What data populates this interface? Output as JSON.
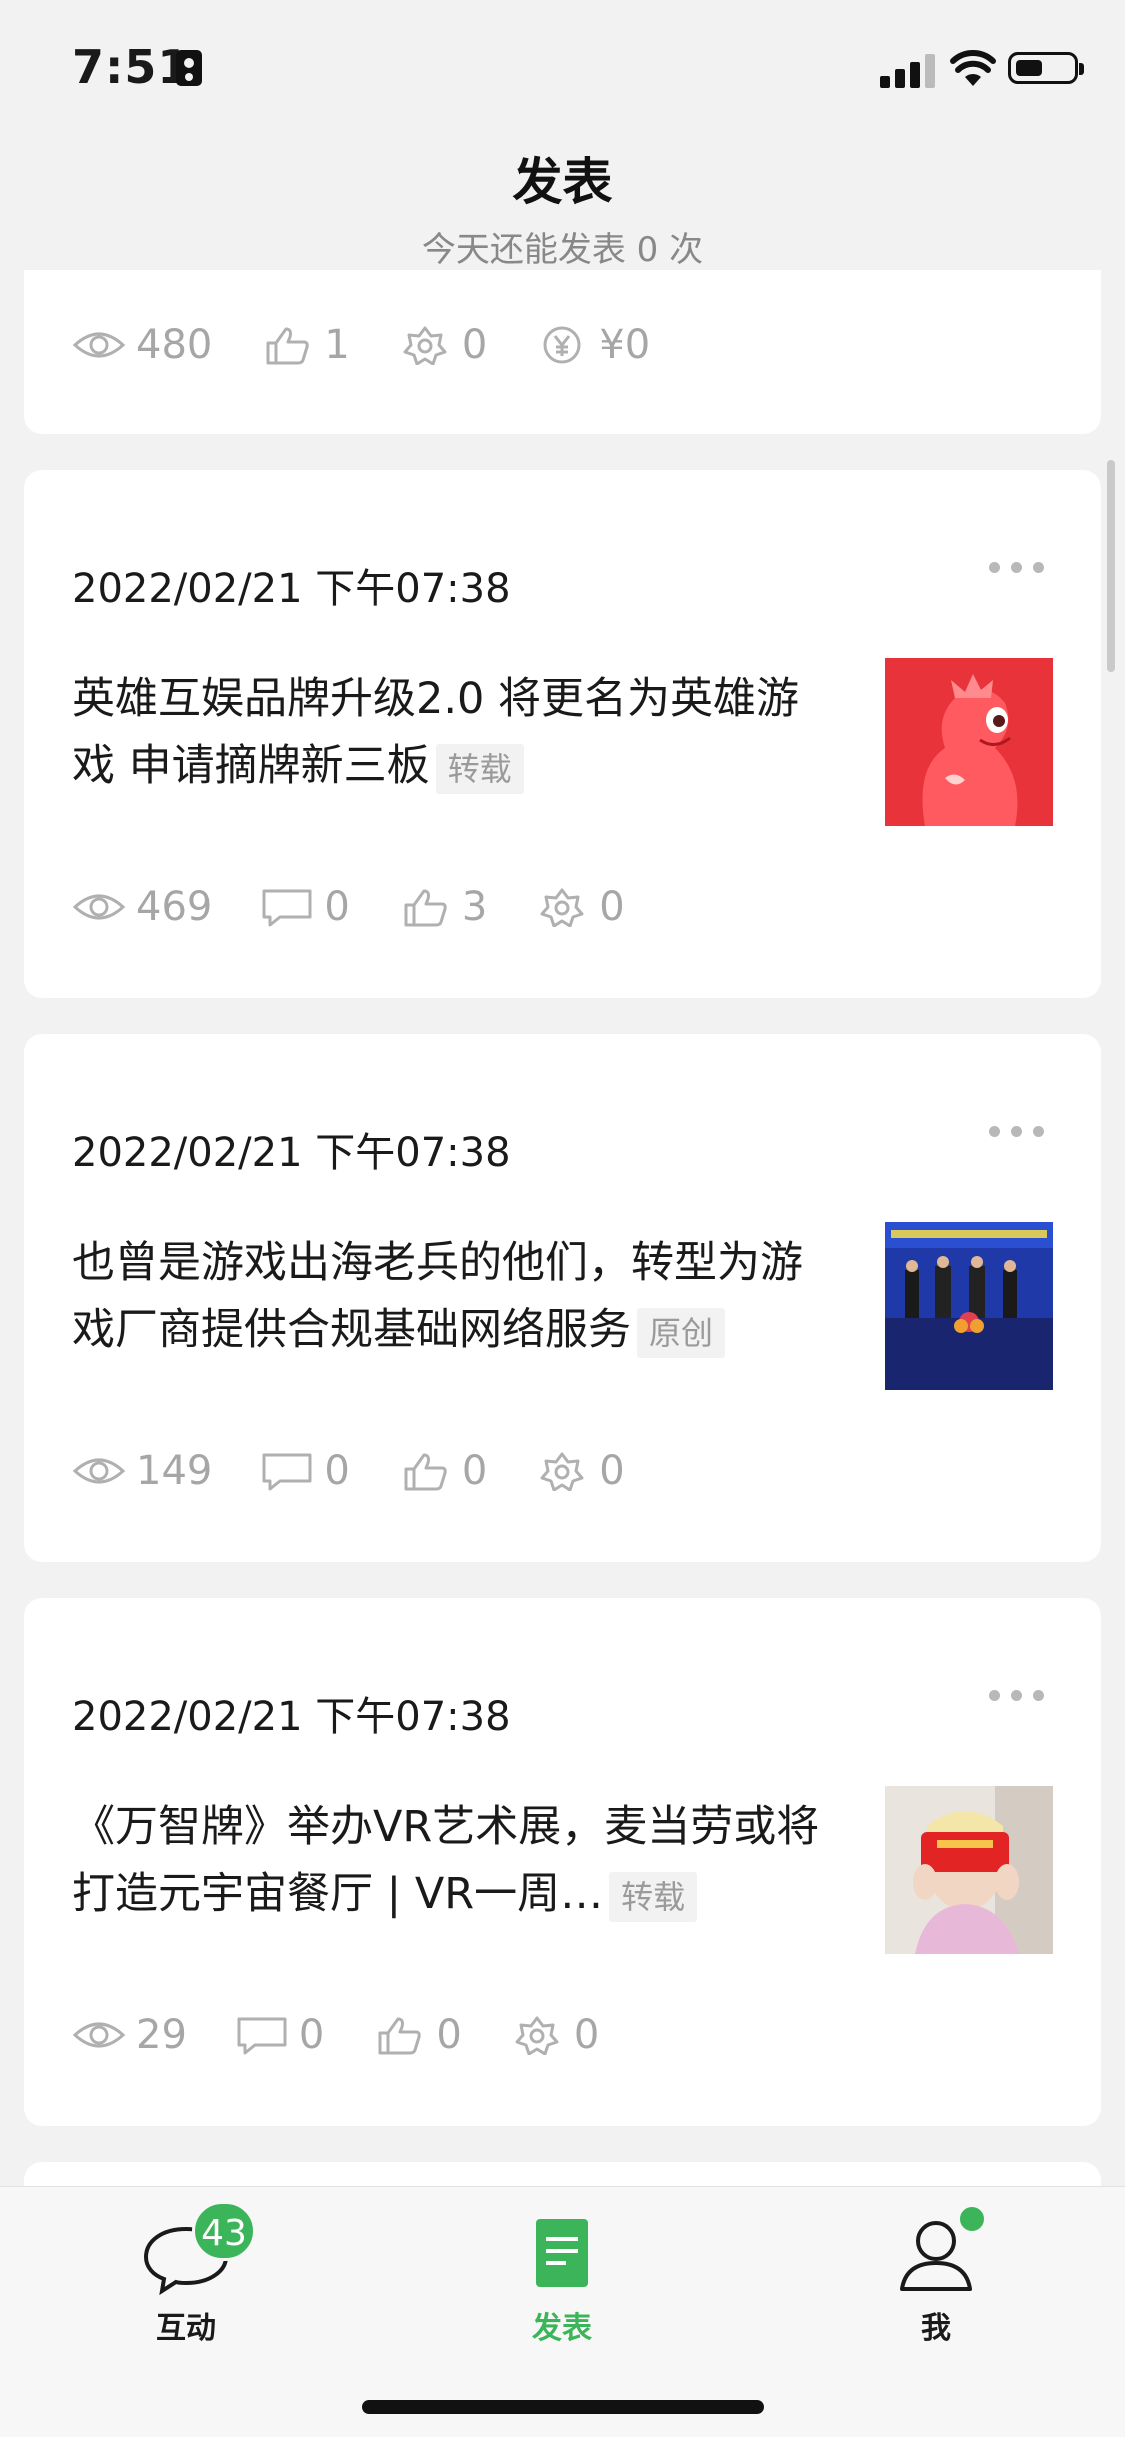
{
  "status_bar": {
    "time": "7:51"
  },
  "header": {
    "title": "发表",
    "subtitle": "今天还能发表 0 次"
  },
  "top_card": {
    "stats": {
      "views": "480",
      "likes": "1",
      "wow": "0",
      "rewards": "¥0"
    }
  },
  "articles": [
    {
      "date": "2022/02/21 下午07:38",
      "title": "英雄互娱品牌升级2.0  将更名为英雄游戏 申请摘牌新三板",
      "tag": "转载",
      "thumbnail": "red-dragon-mascot",
      "stats": {
        "views": "469",
        "comments": "0",
        "likes": "3",
        "wow": "0"
      }
    },
    {
      "date": "2022/02/21 下午07:38",
      "title": "也曾是游戏出海老兵的他们，转型为游戏厂商提供合规基础网络服务",
      "tag": "原创",
      "thumbnail": "signing-ceremony-photo",
      "stats": {
        "views": "149",
        "comments": "0",
        "likes": "0",
        "wow": "0"
      }
    },
    {
      "date": "2022/02/21 下午07:38",
      "title": "《万智牌》举办VR艺术展，麦当劳或将打造元宇宙餐厅 | VR一周…",
      "tag": "转载",
      "thumbnail": "child-with-vr-box-photo",
      "stats": {
        "views": "29",
        "comments": "0",
        "likes": "0",
        "wow": "0"
      }
    }
  ],
  "tab_bar": {
    "interact": {
      "label": "互动",
      "badge": "43"
    },
    "publish": {
      "label": "发表"
    },
    "me": {
      "label": "我"
    }
  },
  "colors": {
    "accent": "#3cb55a",
    "background": "#f2f2f2",
    "muted": "#a6a6a6"
  }
}
